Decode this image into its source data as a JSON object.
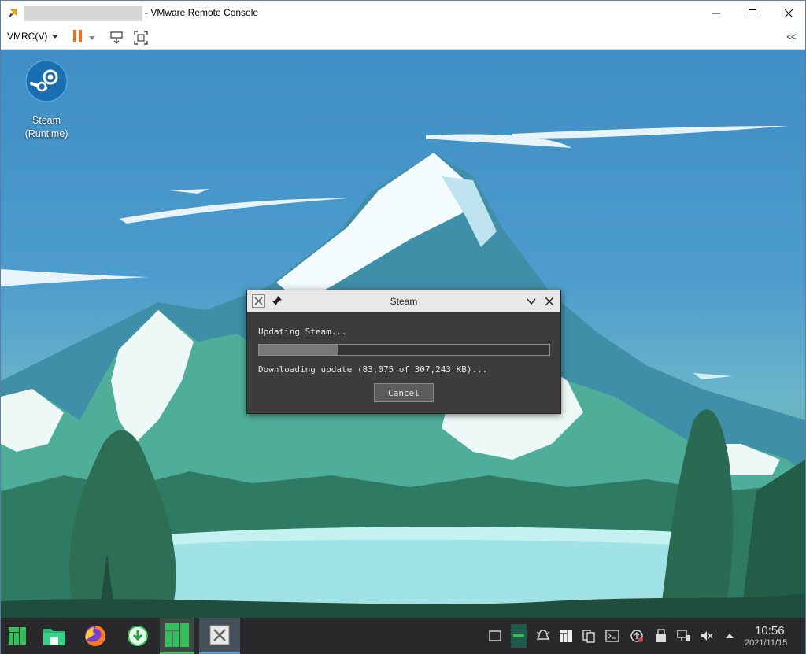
{
  "window": {
    "title": "- VMware Remote Console"
  },
  "toolbar": {
    "vmrc_menu_label": "VMRC(V)"
  },
  "desktop": {
    "icons": [
      {
        "name": "steam-icon",
        "label": "Steam\n(Runtime)",
        "label_line1": "Steam",
        "label_line2": "(Runtime)"
      }
    ]
  },
  "dialog": {
    "title": "Steam",
    "message": "Updating Steam...",
    "progress_fraction": 0.27,
    "status": "Downloading update (83,075 of 307,243 KB)...",
    "cancel_label": "Cancel"
  },
  "taskbar": {
    "apps": [
      "application-launcher",
      "file-manager",
      "firefox",
      "updater",
      "manjaro-settings",
      "steam-update"
    ],
    "clock_time": "10:56",
    "clock_date": "2021/11/15"
  },
  "colors": {
    "accent": "#f07020",
    "taskbar_bg": "#29292b",
    "manjaro_green": "#35bf5c"
  }
}
